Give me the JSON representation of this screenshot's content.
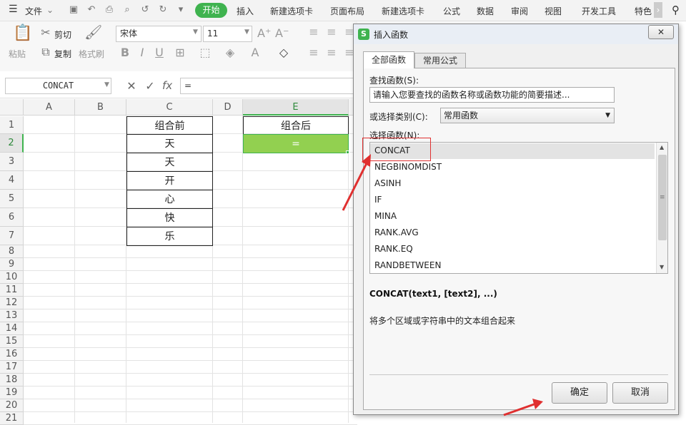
{
  "menubar": {
    "file": "文件",
    "tabs": [
      "开始",
      "插入",
      "新建选项卡",
      "页面布局",
      "新建选项卡",
      "公式",
      "数据",
      "审阅",
      "视图",
      "开发工具",
      "特色"
    ]
  },
  "ribbon": {
    "paste": "粘贴",
    "cut": "剪切",
    "copy": "复制",
    "format_painter": "格式刷",
    "font_name": "宋体",
    "font_size": "11"
  },
  "formula_bar": {
    "name_box": "CONCAT",
    "fx": "fx",
    "formula": "="
  },
  "sheet": {
    "columns": [
      "A",
      "B",
      "C",
      "D",
      "E"
    ],
    "rows": [
      "1",
      "2",
      "3",
      "4",
      "5",
      "6",
      "7",
      "8",
      "9",
      "10",
      "11",
      "12",
      "13",
      "14",
      "15",
      "16",
      "17",
      "18",
      "19",
      "20",
      "21"
    ],
    "c1": "组合前",
    "c_values": [
      "天",
      "天",
      "开",
      "心",
      "快",
      "乐"
    ],
    "e1": "组合后",
    "e2": "="
  },
  "dialog": {
    "title": "插入函数",
    "tabs": [
      "全部函数",
      "常用公式"
    ],
    "search_label": "查找函数(S):",
    "search_placeholder": "请输入您要查找的函数名称或函数功能的简要描述...",
    "category_label": "或选择类别(C):",
    "category_value": "常用函数",
    "select_label": "选择函数(N):",
    "functions": [
      "CONCAT",
      "NEGBINOMDIST",
      "ASINH",
      "IF",
      "MINA",
      "RANK.AVG",
      "RANK.EQ",
      "RANDBETWEEN"
    ],
    "signature": "CONCAT(text1, [text2], ...)",
    "description": "将多个区域或字符串中的文本组合起来",
    "ok": "确定",
    "cancel": "取消"
  },
  "colors": {
    "accent": "#3fb34f",
    "selected_cell": "#92d050",
    "highlight_box": "#e03030"
  }
}
